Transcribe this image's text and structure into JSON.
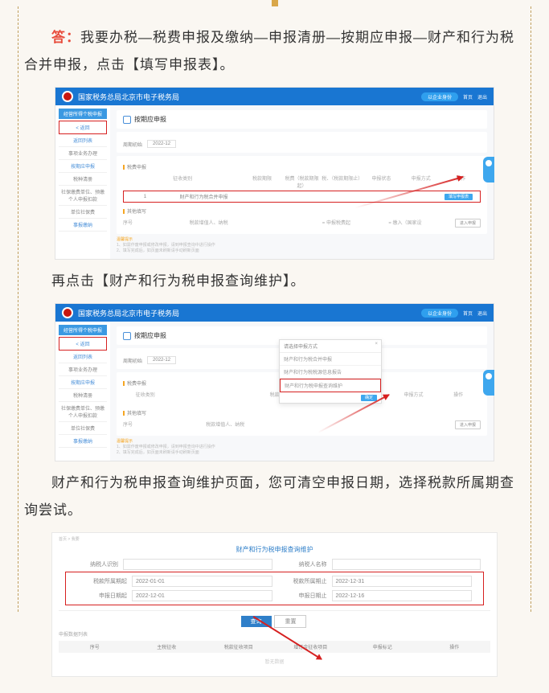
{
  "intro": {
    "answer_label": "答：",
    "answer_text": "我要办税—税费申报及缴纳—申报清册—按期应申报—财产和行为税合并申报，点击【填写申报表】。"
  },
  "shot1": {
    "header_title": "国家税务总局北京市电子税务局",
    "hdr_pill": "以企业身份",
    "hdr_links": [
      "首页",
      "退出"
    ],
    "sidebar_top": "经营所得个税申报",
    "sidebar": [
      "< 返回",
      "返回列表",
      "事项业务办理",
      "按期应申报",
      "税种清册",
      "社保缴费单位、预缴个人申报扣款",
      "单位社保费",
      "事报缴纳"
    ],
    "panel_title": "按期应申报",
    "period_label": "周期初始",
    "period_value": "2022-12",
    "section1": "税费申报",
    "cols": [
      "",
      "征收类别",
      "",
      "税款期限",
      "税费（税款期限起）",
      "税、（税款期限止）",
      "申报状态",
      "申报方式",
      "操作"
    ],
    "row_item": "财产和行为税合并申报",
    "row_btn": "填写申报表",
    "section2": "其他填写",
    "bottom": [
      "序号",
      "税款增值人、纳税",
      "",
      "= 申报税费起",
      "= 缴入（国家设"
    ],
    "bottom_btn": "进入申报",
    "hints": [
      "温馨提示",
      "1、如需作废申报或修改申报，请到申报查询中进行操作",
      "2、填写完成后，如页面未刷新请手动刷新页面"
    ]
  },
  "mid_text": "再点击【财产和行为税申报查询维护】。",
  "shot2": {
    "header_title": "国家税务总局北京市电子税务局",
    "panel_title": "按期应申报",
    "period_value": "2022-12",
    "dialog_title": "请选择申报方式",
    "dialog_items": [
      "财产和行为税合并申报",
      "财产和行为税税源信息报告",
      "财产和行为税申报查询维护"
    ],
    "dialog_ok": "确定"
  },
  "mid_text2": "财产和行为税申报查询维护页面，您可清空申报日期，选择税款所属期查询尝试。",
  "shot3": {
    "crumb": "首页 > 我要",
    "title": "财产和行为税申报查询维护",
    "row_top_l": "纳税人识别",
    "row_top_r": "纳税人名称",
    "rows": [
      {
        "l_label": "税款所属期起",
        "l_value": "2022-01-01",
        "r_label": "税款所属期止",
        "r_value": "2022-12-31"
      },
      {
        "l_label": "申报日期起",
        "l_value": "2022-12-01",
        "r_label": "申报日期止",
        "r_value": "2022-12-16"
      }
    ],
    "btn_query": "查询",
    "btn_reset": "重置",
    "section": "申报数据列表",
    "cols": [
      "序号",
      "主税征收",
      "税款征收项目",
      "增订金征收项目",
      "申报标记",
      "操作"
    ],
    "empty": "暂无数据"
  }
}
